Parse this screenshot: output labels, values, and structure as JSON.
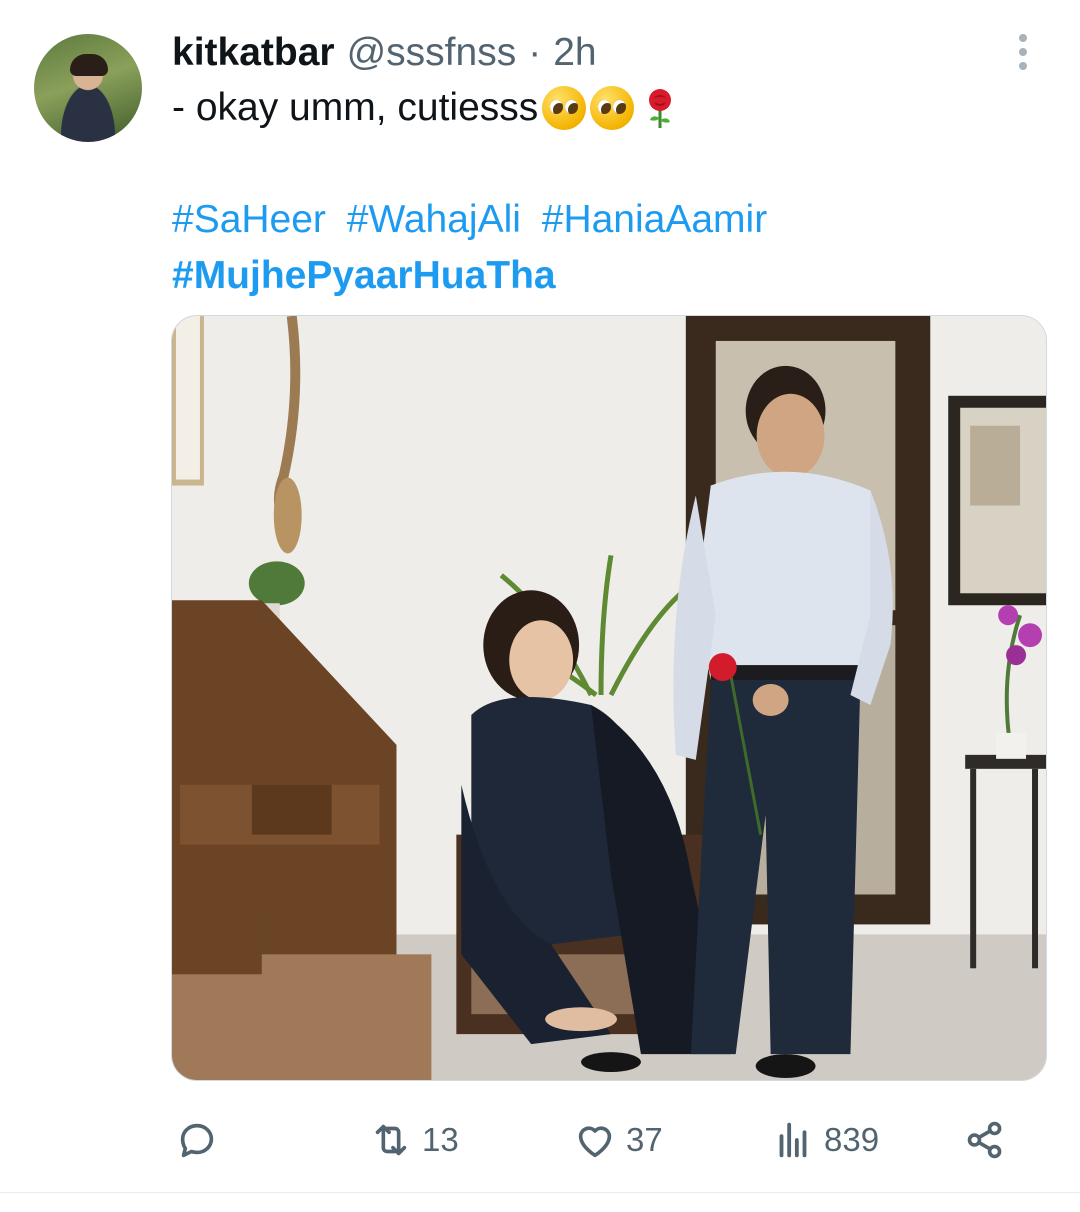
{
  "tweet": {
    "display_name": "kitkatbar",
    "handle": "@sssfnss",
    "separator": "·",
    "time": "2h",
    "text": "- okay umm, cutiesss",
    "emojis": [
      "pleading-face",
      "pleading-face",
      "rose"
    ],
    "hashtags_row1": [
      "#SaHeer",
      "#WahajAli",
      "#HaniaAamir"
    ],
    "hashtag_row2": "#MujhePyaarHuaTha",
    "media_alt": ""
  },
  "actions": {
    "reply_icon": "reply-icon",
    "retweet_count": "13",
    "like_count": "37",
    "views_count": "839",
    "share_icon": "share-icon"
  },
  "colors": {
    "text": "#0f1419",
    "secondary": "#536471",
    "link": "#1d9bf0"
  }
}
